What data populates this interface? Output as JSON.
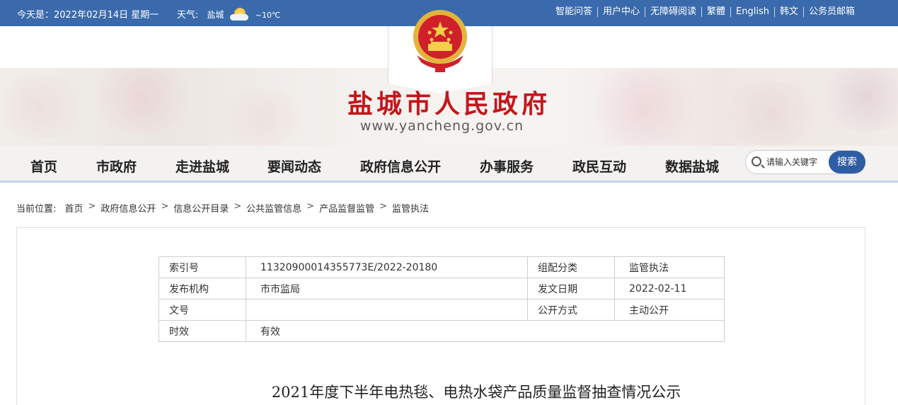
{
  "topbar": {
    "date_text": "今天是：2022年02月14日 星期一",
    "weather_label": "天气:",
    "city": "盐城",
    "temperature": "~10℃",
    "weather_icon": "sun-cloud-icon",
    "links": [
      "智能问答",
      "用户中心",
      "无障碍阅读",
      "繁體",
      "English",
      "韩文",
      "公务员邮箱"
    ]
  },
  "banner": {
    "title": "盐城市人民政府",
    "url": "www.yancheng.gov.cn",
    "emblem_icon": "national-emblem-icon"
  },
  "nav": {
    "items": [
      "首页",
      "市政府",
      "走进盐城",
      "要闻动态",
      "政府信息公开",
      "办事服务",
      "政民互动",
      "数据盐城"
    ]
  },
  "search": {
    "placeholder": "请输入关键字",
    "button_label": "搜索"
  },
  "breadcrumb": {
    "label": "当前位置:",
    "items": [
      "首页",
      "政府信息公开",
      "信息公开目录",
      "公共监管信息",
      "产品监督监管",
      "监管执法"
    ]
  },
  "meta_table": {
    "rows": [
      [
        "索引号",
        "11320900014355773E/2022-20180",
        "组配分类",
        "监管执法"
      ],
      [
        "发布机构",
        "市市监局",
        "发文日期",
        "2022-02-11"
      ],
      [
        "文号",
        "",
        "公开方式",
        "主动公开"
      ],
      [
        "时效",
        "有效"
      ]
    ]
  },
  "article": {
    "title": "2021年度下半年电热毯、电热水袋产品质量监督抽查情况公示"
  },
  "colors": {
    "topbar_bg": "#3a6aab",
    "title_red": "#c3161c",
    "search_button": "#2f5da3"
  }
}
